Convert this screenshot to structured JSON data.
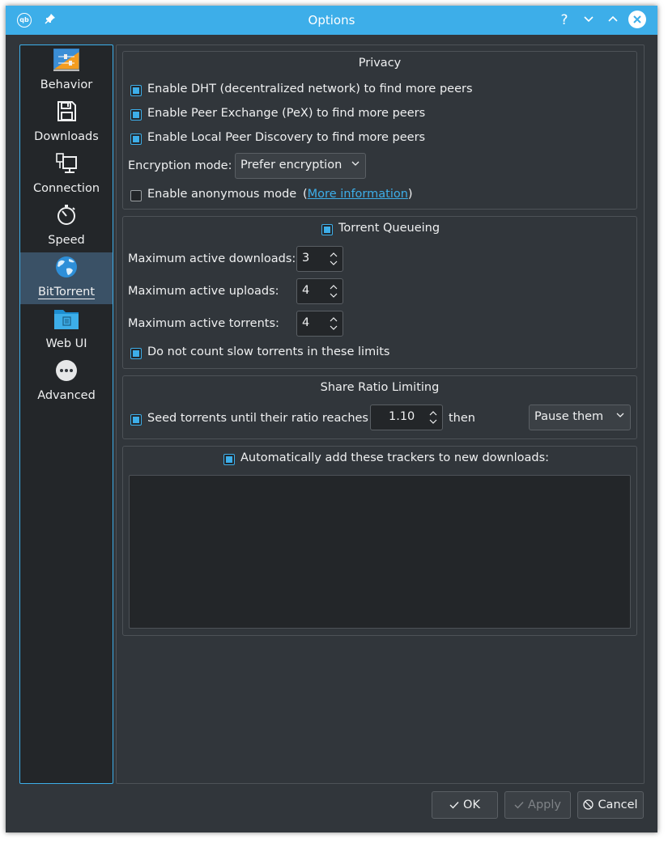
{
  "window": {
    "title": "Options",
    "app_icon_text": "qb",
    "help_label": "?"
  },
  "sidebar": {
    "items": [
      {
        "label": "Behavior",
        "icon": "behavior-icon"
      },
      {
        "label": "Downloads",
        "icon": "save-icon"
      },
      {
        "label": "Connection",
        "icon": "network-icon"
      },
      {
        "label": "Speed",
        "icon": "stopwatch-icon"
      },
      {
        "label": "BitTorrent",
        "icon": "globe-icon",
        "active": true
      },
      {
        "label": "Web UI",
        "icon": "folder-icon"
      },
      {
        "label": "Advanced",
        "icon": "more-icon"
      }
    ]
  },
  "privacy": {
    "title": "Privacy",
    "dht": {
      "label": "Enable DHT (decentralized network) to find more peers",
      "checked": true
    },
    "pex": {
      "label": "Enable Peer Exchange (PeX) to find more peers",
      "checked": true
    },
    "lpd": {
      "label": "Enable Local Peer Discovery to find more peers",
      "checked": true
    },
    "encryption_label": "Encryption mode:",
    "encryption_value": "Prefer encryption",
    "anonymous": {
      "label": "Enable anonymous mode",
      "checked": false
    },
    "more_info_open": "(",
    "more_info_link": "More information",
    "more_info_close": ")"
  },
  "queueing": {
    "title": "Torrent Queueing",
    "checked": true,
    "max_downloads_label": "Maximum active downloads:",
    "max_downloads": "3",
    "max_uploads_label": "Maximum active uploads:",
    "max_uploads": "4",
    "max_torrents_label": "Maximum active torrents:",
    "max_torrents": "4",
    "slow": {
      "label": "Do not count slow torrents in these limits",
      "checked": true
    }
  },
  "ratio": {
    "title": "Share Ratio Limiting",
    "seed_label": "Seed torrents until their ratio reaches",
    "seed_checked": true,
    "ratio_value": "1.10",
    "then_label": "then",
    "action_value": "Pause them"
  },
  "trackers": {
    "label": "Automatically add these trackers to new downloads:",
    "checked": true,
    "text": ""
  },
  "buttons": {
    "ok": "OK",
    "apply": "Apply",
    "cancel": "Cancel"
  },
  "colors": {
    "accent": "#3daee9",
    "window_bg": "#31363b",
    "field_bg": "#232629"
  }
}
